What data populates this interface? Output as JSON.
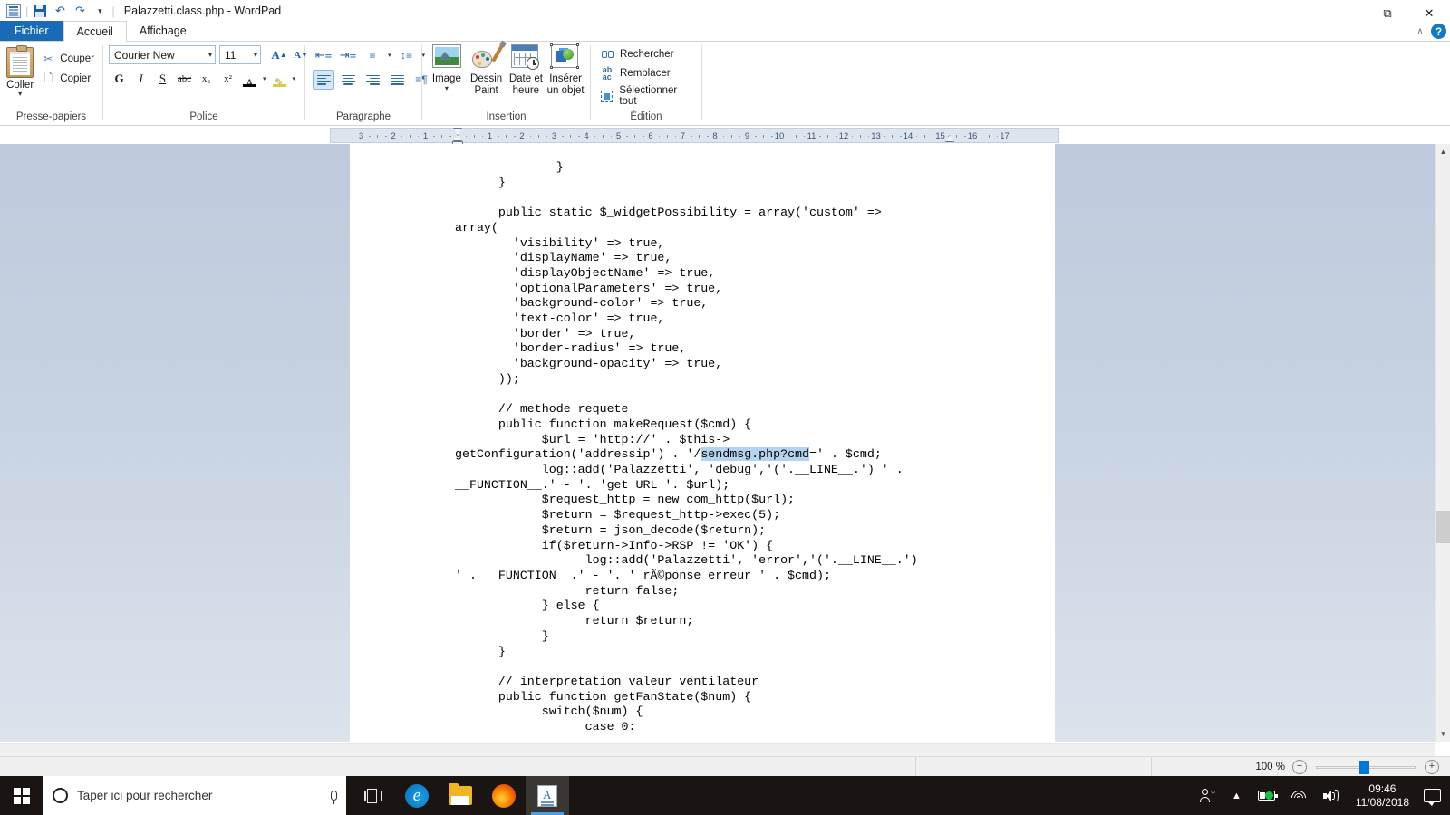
{
  "window": {
    "title": "Palazzetti.class.php - WordPad",
    "app_icon": "wordpad-document-icon",
    "quick_access": [
      {
        "name": "save-icon",
        "label": "Enregistrer"
      },
      {
        "name": "undo-icon",
        "label": "Annuler"
      },
      {
        "name": "redo-icon",
        "label": "Rétablir"
      },
      {
        "name": "customize-qat-icon",
        "label": "Personnaliser"
      }
    ],
    "controls": {
      "minimize": "—",
      "maximize": "❐",
      "close": "✕",
      "collapse_ribbon": "∧",
      "help": "?"
    }
  },
  "tabs": [
    {
      "label": "Fichier",
      "name": "tab-fichier",
      "state": "file-menu"
    },
    {
      "label": "Accueil",
      "name": "tab-accueil",
      "state": "active"
    },
    {
      "label": "Affichage",
      "name": "tab-affichage",
      "state": "normal"
    }
  ],
  "ribbon": {
    "clipboard": {
      "group_label": "Presse-papiers",
      "paste_label": "Coller",
      "cut_label": "Couper",
      "copy_label": "Copier"
    },
    "font": {
      "group_label": "Police",
      "font_name": "Courier New",
      "font_size": "11",
      "grow_label": "A",
      "shrink_label": "A",
      "bold": "G",
      "italic": "I",
      "underline": "S",
      "strike": "abc",
      "subscript": "x₂",
      "superscript": "x²",
      "text_color_letter": "A",
      "highlight_letter": "✎"
    },
    "paragraph": {
      "group_label": "Paragraphe",
      "buttons": [
        "decrease-indent",
        "increase-indent",
        "bullets",
        "line-spacing",
        "align-left",
        "align-center",
        "align-right",
        "justify",
        "paragraph-marks"
      ]
    },
    "insertion": {
      "group_label": "Insertion",
      "items": [
        {
          "label": "Image",
          "name": "insert-image",
          "has_dropdown": true
        },
        {
          "label": "Dessin Paint",
          "name": "insert-paint-drawing",
          "has_dropdown": false
        },
        {
          "label": "Date et heure",
          "name": "insert-date-time",
          "has_dropdown": false
        },
        {
          "label": "Insérer un objet",
          "name": "insert-object",
          "has_dropdown": false
        }
      ]
    },
    "edition": {
      "group_label": "Édition",
      "items": [
        {
          "label": "Rechercher",
          "name": "find"
        },
        {
          "label": "Remplacer",
          "name": "replace"
        },
        {
          "label": "Sélectionner tout",
          "name": "select-all"
        }
      ]
    }
  },
  "ruler": {
    "left_numbers": [
      "3",
      "2",
      "1"
    ],
    "right_numbers": [
      "1",
      "2",
      "3",
      "4",
      "5",
      "6",
      "7",
      "8",
      "9",
      "10",
      "11",
      "12",
      "13",
      "14",
      "15",
      "16",
      "17"
    ],
    "first_line_indent_pos": "0",
    "right_indent_pos": "14.5"
  },
  "document": {
    "lines": [
      "              }",
      "      }",
      "",
      "      public static $_widgetPossibility = array('custom' =>",
      "array(",
      "        'visibility' => true,",
      "        'displayName' => true,",
      "        'displayObjectName' => true,",
      "        'optionalParameters' => true,",
      "        'background-color' => true,",
      "        'text-color' => true,",
      "        'border' => true,",
      "        'border-radius' => true,",
      "        'background-opacity' => true,",
      "      ));",
      "",
      "      // methode requete",
      "      public function makeRequest($cmd) {",
      "            $url = 'http://' . $this->",
      "getConfiguration('addressip') . '/"
    ],
    "selected_text": "sendmsg.php?cmd",
    "lines_after_selection": [
      "=' . $cmd;",
      "            log::add('Palazzetti', 'debug','('.__LINE__.') ' .",
      "__FUNCTION__.' - '. 'get URL '. $url);",
      "            $request_http = new com_http($url);",
      "            $return = $request_http->exec(5);",
      "            $return = json_decode($return);",
      "            if($return->Info->RSP != 'OK') {",
      "                  log::add('Palazzetti', 'error','('.__LINE__.')",
      "' . __FUNCTION__.' - '. ' rÃ©ponse erreur ' . $cmd);",
      "                  return false;",
      "            } else {",
      "                  return $return;",
      "            }",
      "      }",
      "",
      "      // interpretation valeur ventilateur",
      "      public function getFanState($num) {",
      "            switch($num) {",
      "                  case 0:"
    ]
  },
  "statusbar": {
    "zoom_level": "100 %",
    "zoom_out": "−",
    "zoom_in": "+"
  },
  "taskbar": {
    "start_label": "Démarrer",
    "search_placeholder": "Taper ici pour rechercher",
    "apps": [
      {
        "name": "task-view-icon",
        "label": "Affichage des tâches"
      },
      {
        "name": "edge-icon",
        "label": "Microsoft Edge"
      },
      {
        "name": "file-explorer-icon",
        "label": "Explorateur de fichiers"
      },
      {
        "name": "firefox-icon",
        "label": "Mozilla Firefox"
      },
      {
        "name": "wordpad-taskbar-icon",
        "label": "WordPad",
        "active": true
      }
    ],
    "tray": {
      "time": "09:46",
      "date": "11/08/2018",
      "icons": [
        "people-icon",
        "show-hidden-icons-chevron",
        "battery-icon",
        "wifi-icon",
        "volume-icon",
        "action-center-icon"
      ]
    }
  },
  "colors": {
    "accent": "#0078d7",
    "file_tab": "#1a6bb5",
    "selection_highlight": "#b5d3ef",
    "taskbar": "#1a1512",
    "doc_background": "#c6d1e1"
  }
}
